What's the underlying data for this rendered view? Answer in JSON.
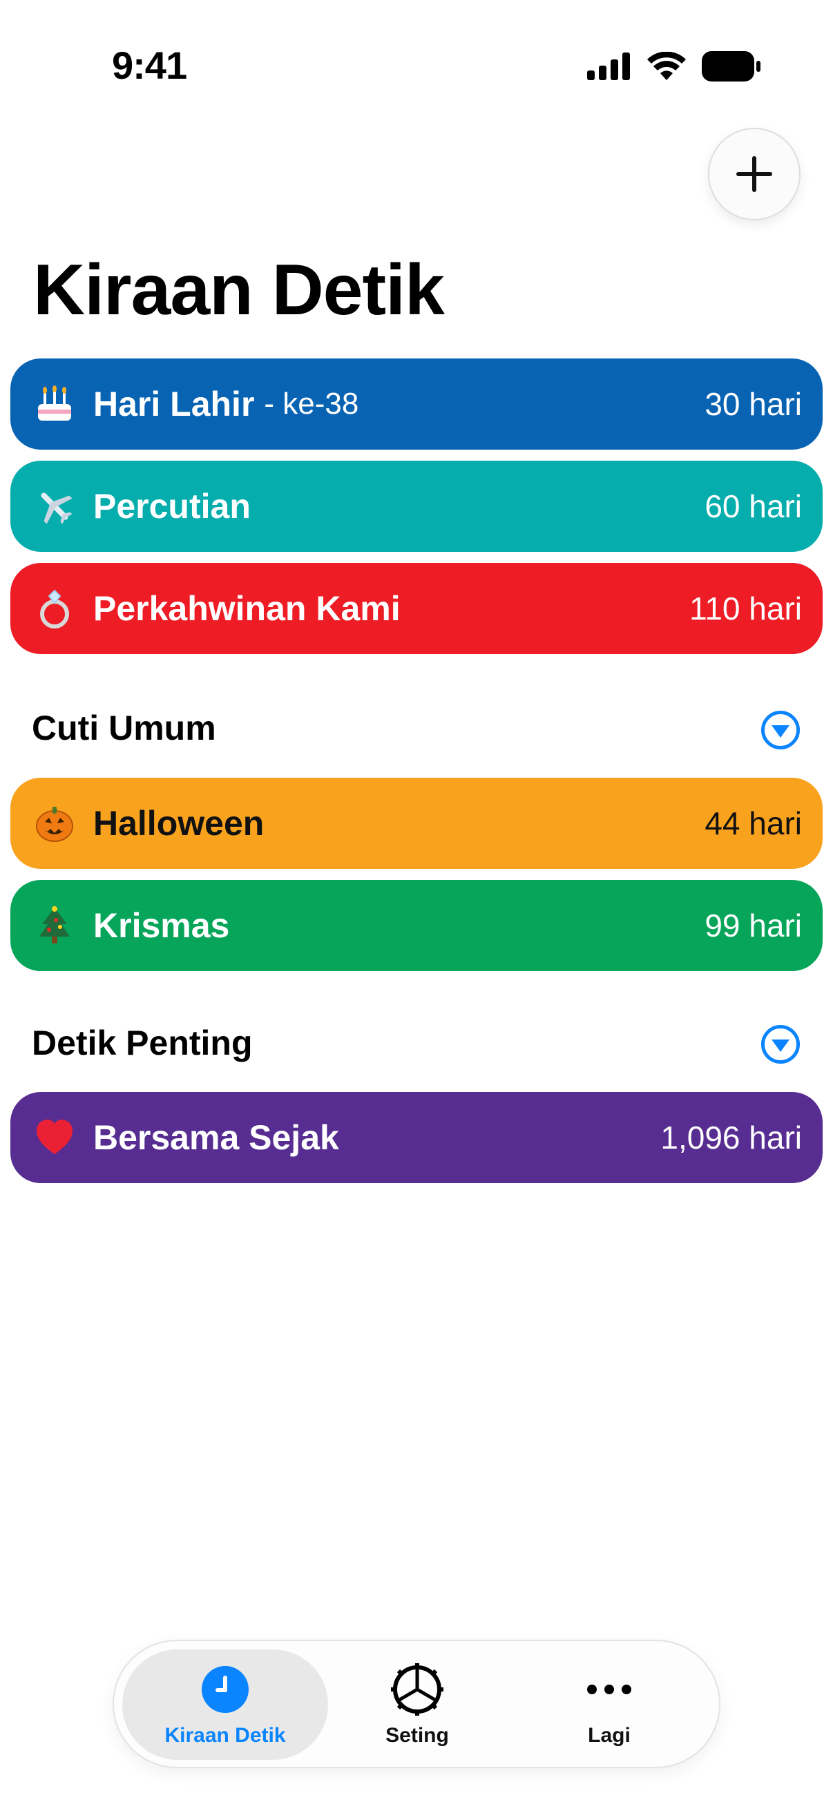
{
  "status": {
    "time": "9:41"
  },
  "page": {
    "title": "Kiraan Detik"
  },
  "cards": [
    {
      "emoji": "birthday-cake-icon",
      "title": "Hari Lahir",
      "subtitle": "- ke-38",
      "value": "30 hari",
      "color": "#0863B3"
    },
    {
      "emoji": "airplane-icon",
      "title": "Percutian",
      "subtitle": "",
      "value": "60 hari",
      "color": "#05ADAD"
    },
    {
      "emoji": "ring-icon",
      "title": "Perkahwinan Kami",
      "subtitle": "",
      "value": "110 hari",
      "color": "#ED1C25"
    }
  ],
  "sections": [
    {
      "title": "Cuti Umum",
      "cards": [
        {
          "emoji": "jack-o-lantern-icon",
          "title": "Halloween",
          "value": "44 hari",
          "color": "#F8A21E"
        },
        {
          "emoji": "christmas-tree-icon",
          "title": "Krismas",
          "value": "99 hari",
          "color": "#06A55A"
        }
      ]
    },
    {
      "title": "Detik Penting",
      "cards": [
        {
          "emoji": "red-heart-icon",
          "title": "Bersama Sejak",
          "value": "1,096 hari",
          "color": "#582D91"
        }
      ]
    }
  ],
  "tabs": [
    {
      "label": "Kiraan Detik",
      "icon": "clock-icon",
      "active": true
    },
    {
      "label": "Seting",
      "icon": "gear-icon",
      "active": false
    },
    {
      "label": "Lagi",
      "icon": "more-dots-icon",
      "active": false
    }
  ],
  "colors": {
    "accent": "#0A84FF"
  }
}
